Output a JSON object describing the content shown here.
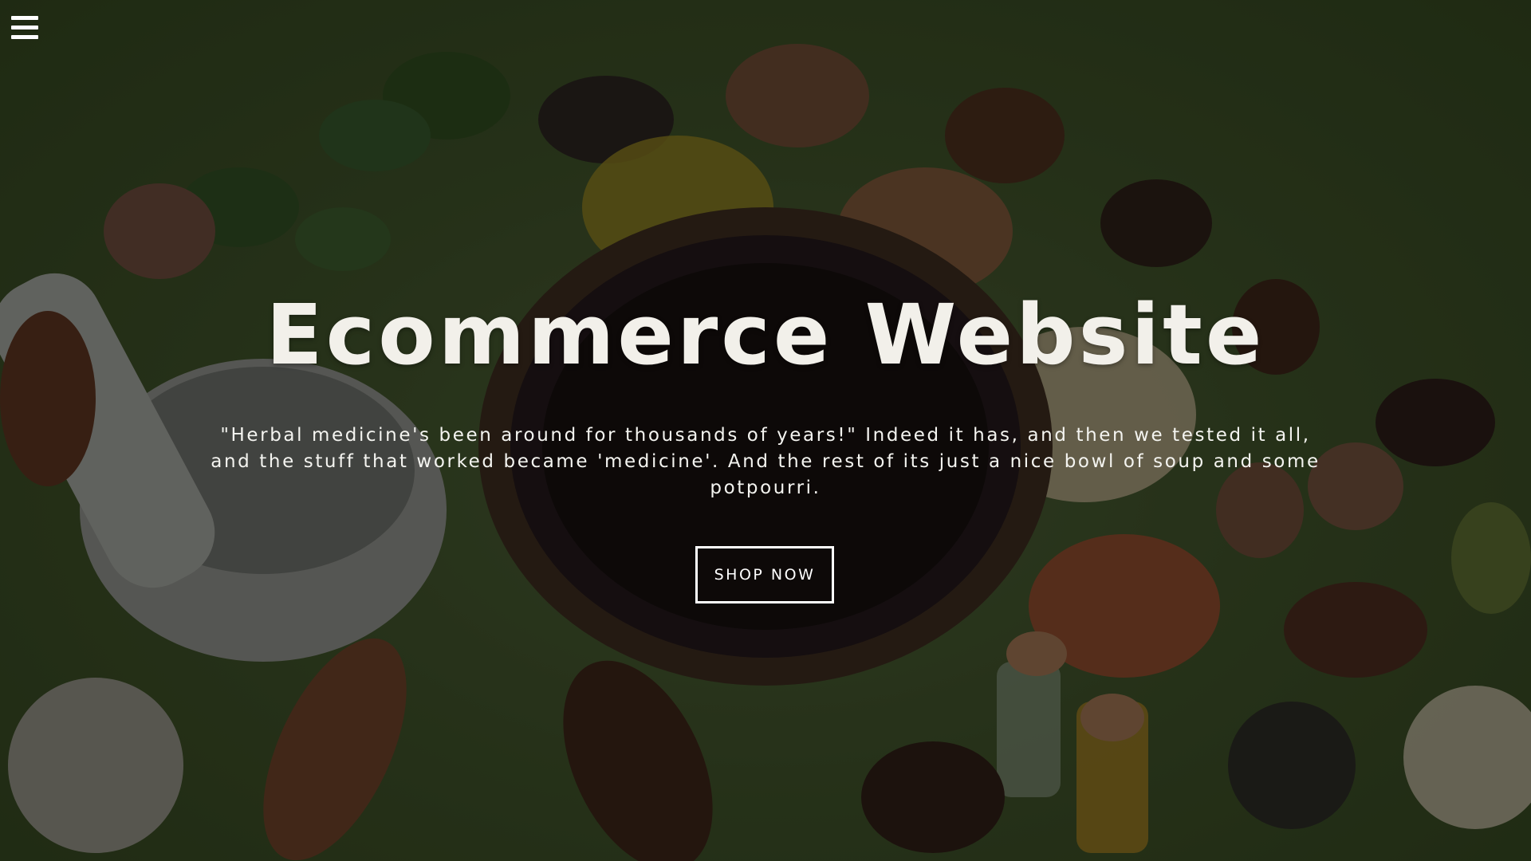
{
  "nav": {
    "menu_icon": "hamburger-menu-icon"
  },
  "hero": {
    "title": "Ecommerce Website",
    "text": "\"Herbal medicine's been around for thousands of years!\" Indeed it has, and then we tested it all, and the stuff that worked became 'medicine'. And the rest of its just a nice bowl of soup and some potpourri.",
    "button_label": "SHOP NOW"
  },
  "colors": {
    "background": "#3e5029",
    "text": "#ffffff"
  }
}
